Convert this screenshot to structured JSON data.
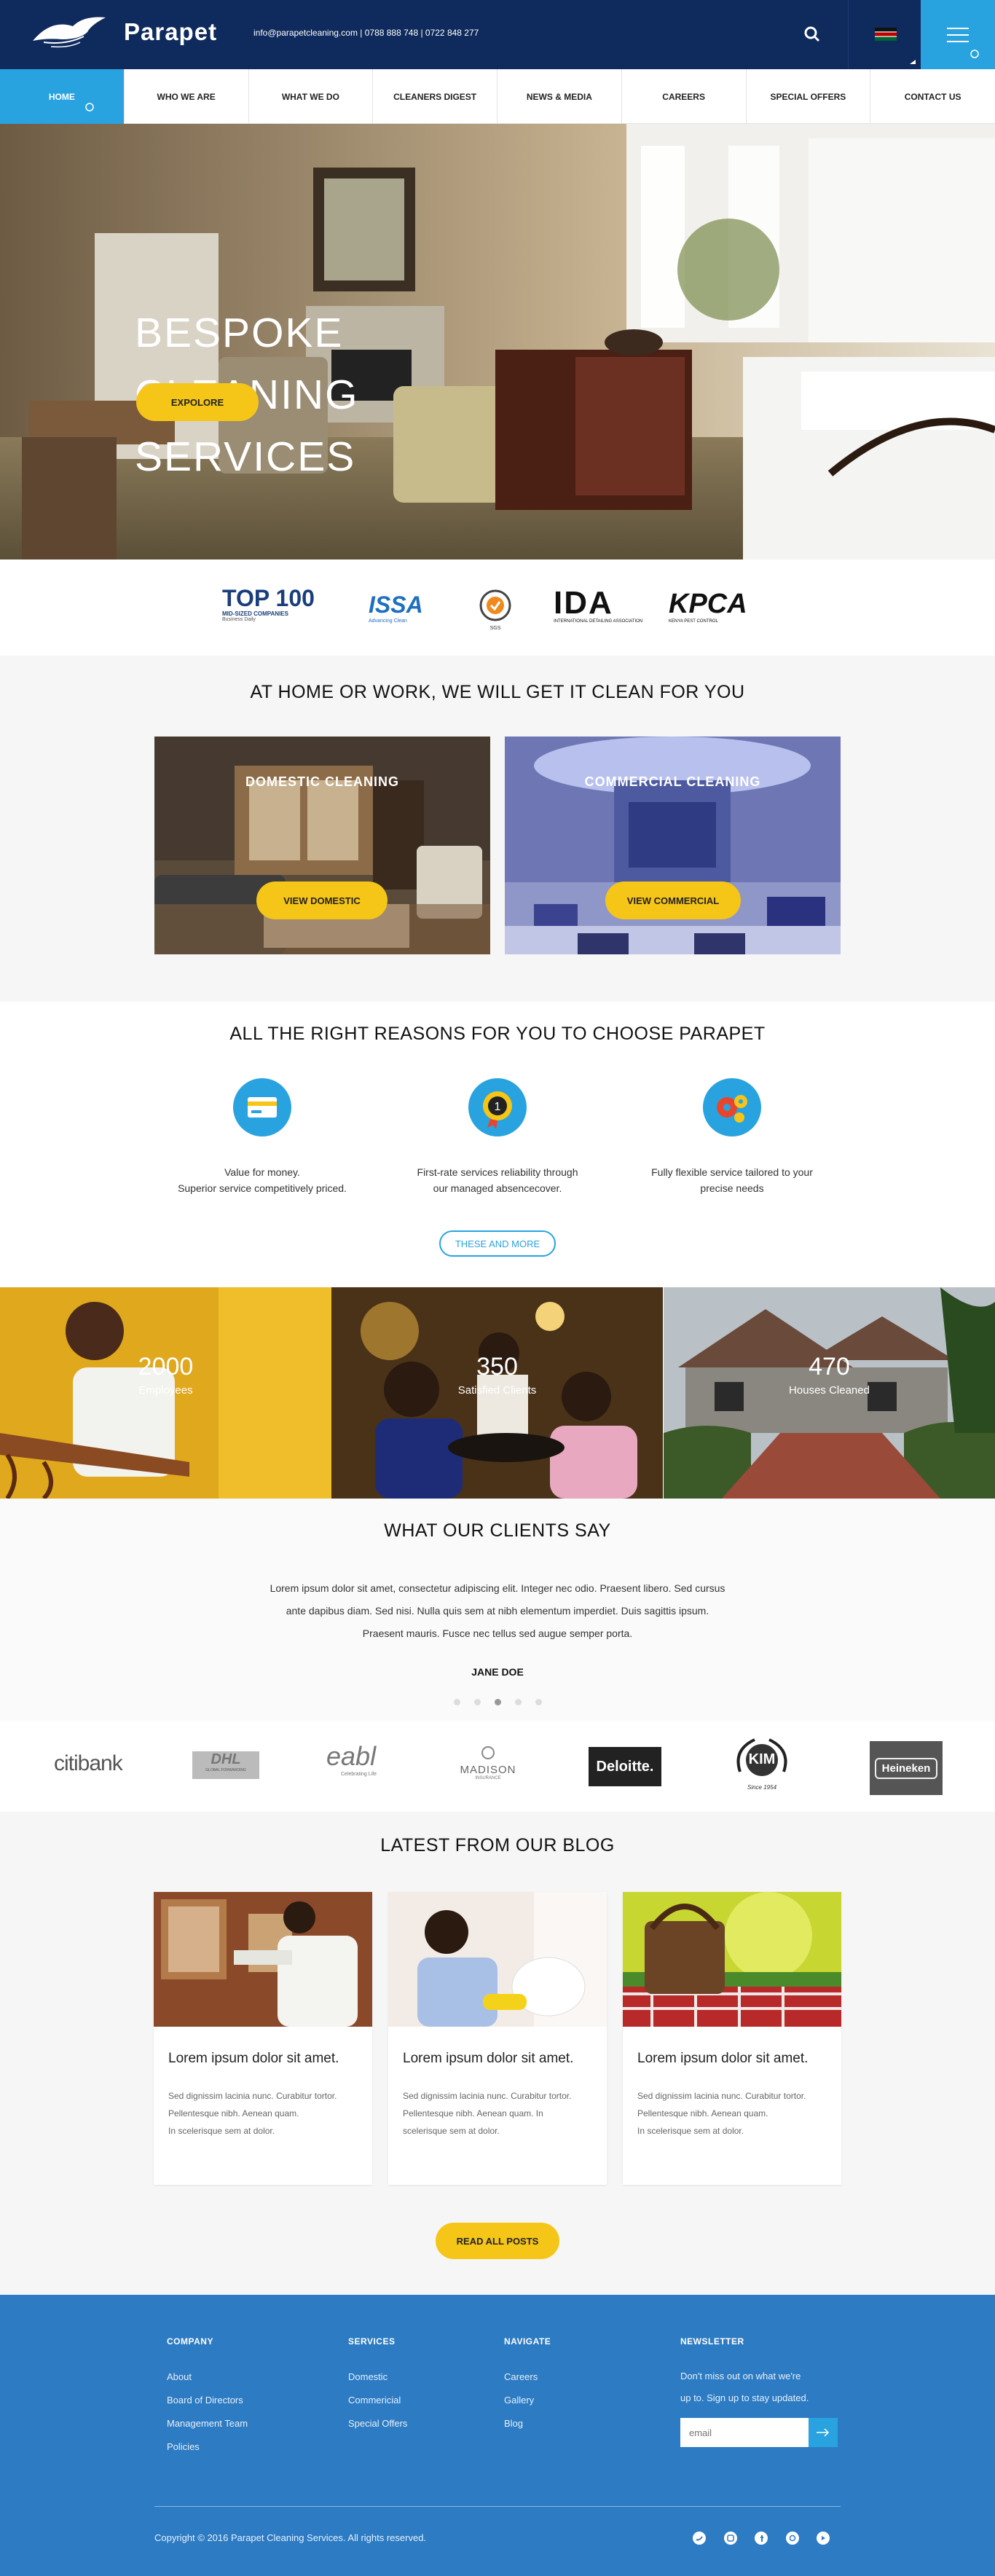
{
  "header": {
    "brand": "Parapet",
    "contact": "info@parapetcleaning.com | 0788 888 748 | 0722 848 277"
  },
  "nav": {
    "items": [
      "HOME",
      "WHO WE ARE",
      "WHAT WE DO",
      "CLEANERS DIGEST",
      "NEWS & MEDIA",
      "CAREERS",
      "SPECIAL OFFERS",
      "CONTACT US"
    ]
  },
  "hero": {
    "line1": "BESPOKE",
    "line2": "CLEANING",
    "line3": "SERVICES",
    "button": "EXPOLORE"
  },
  "accreditations": {
    "top100_big": "TOP 100",
    "top100_small": "MID-SIZED COMPANIES",
    "top100_sub": "Business Daily",
    "issa": "ISSA",
    "issa_sub": "Advancing Clean",
    "sgs": "SGS",
    "ida": "IDA",
    "ida_sub": "INTERNATIONAL DETAILING ASSOCIATION",
    "kpca": "KPCA",
    "kpca_sub": "KENYA PEST CONTROL"
  },
  "services": {
    "title": "AT HOME OR WORK, WE WILL GET IT CLEAN FOR YOU",
    "domestic_label": "DOMESTIC CLEANING",
    "domestic_button": "VIEW DOMESTIC",
    "commercial_label": "COMMERCIAL CLEANING",
    "commercial_button": "VIEW COMMERCIAL"
  },
  "reasons": {
    "title": "ALL THE RIGHT REASONS FOR YOU TO CHOOSE PARAPET",
    "r1_line1": "Value for money.",
    "r1_line2": "Superior service competitively priced.",
    "r2_line1": "First-rate services reliability through",
    "r2_line2": "our managed absencecover.",
    "r3_line1": "Fully flexible service tailored to your",
    "r3_line2": "precise needs",
    "button": "THESE AND MORE"
  },
  "stats": [
    {
      "value": "2000",
      "label": "Employees"
    },
    {
      "value": "350",
      "label": "Satisfied Clients"
    },
    {
      "value": "470",
      "label": "Houses Cleaned"
    }
  ],
  "testimonials": {
    "title": "WHAT OUR CLIENTS SAY",
    "quote": "Lorem ipsum dolor sit amet, consectetur adipiscing elit. Integer nec odio. Praesent libero. Sed cursus ante dapibus diam. Sed nisi. Nulla quis sem at nibh elementum imperdiet. Duis sagittis ipsum. Praesent mauris. Fusce nec tellus sed augue semper porta.",
    "author": "JANE DOE",
    "active_dot": 3,
    "dots": 5
  },
  "partners": {
    "citibank": "citibank",
    "dhl": "DHL",
    "dhl_sub": "GLOBAL FORWARDING",
    "eabl": "eabl",
    "eabl_sub": "Celebrating Life",
    "madison": "MADISON",
    "madison_sub": "INSURANCE",
    "deloitte": "Deloitte.",
    "kim": "KIM",
    "kim_sub": "Since 1954",
    "heineken": "Heineken"
  },
  "blog": {
    "title": "LATEST FROM OUR BLOG",
    "posts": [
      {
        "title": "Lorem ipsum dolor sit amet.",
        "l1": "Sed dignissim lacinia nunc. Curabitur tortor.",
        "l2": "Pellentesque nibh. Aenean quam.",
        "l3": "In scelerisque sem at dolor."
      },
      {
        "title": "Lorem ipsum dolor sit amet.",
        "l1": "Sed dignissim lacinia nunc. Curabitur tortor.",
        "l2": "Pellentesque nibh. Aenean quam. In",
        "l3": "scelerisque sem at dolor."
      },
      {
        "title": "Lorem ipsum dolor sit amet.",
        "l1": "Sed dignissim lacinia nunc. Curabitur tortor.",
        "l2": "Pellentesque nibh. Aenean quam.",
        "l3": "In scelerisque sem at dolor."
      }
    ],
    "button": "READ ALL POSTS"
  },
  "footer": {
    "company_head": "COMPANY",
    "company": [
      "About",
      "Board of Directors",
      "Management Team",
      "Policies"
    ],
    "services_head": "SERVICES",
    "services": [
      "Domestic",
      "Commericial",
      "Special Offers"
    ],
    "navigate_head": "NAVIGATE",
    "navigate": [
      "Careers",
      "Gallery",
      "Blog"
    ],
    "newsletter_head": "NEWSLETTER",
    "newsletter_l1": "Don't miss out on what we're",
    "newsletter_l2": "up to. Sign up to stay updated.",
    "email_placeholder": "email",
    "copyright": "Copyright © 2016 Parapet Cleaning Services.  All rights reserved."
  },
  "colors": {
    "navy": "#0f2a5c",
    "accent_blue": "#29a3df",
    "yellow": "#f5c518",
    "footer_blue": "#2c7bc3"
  }
}
